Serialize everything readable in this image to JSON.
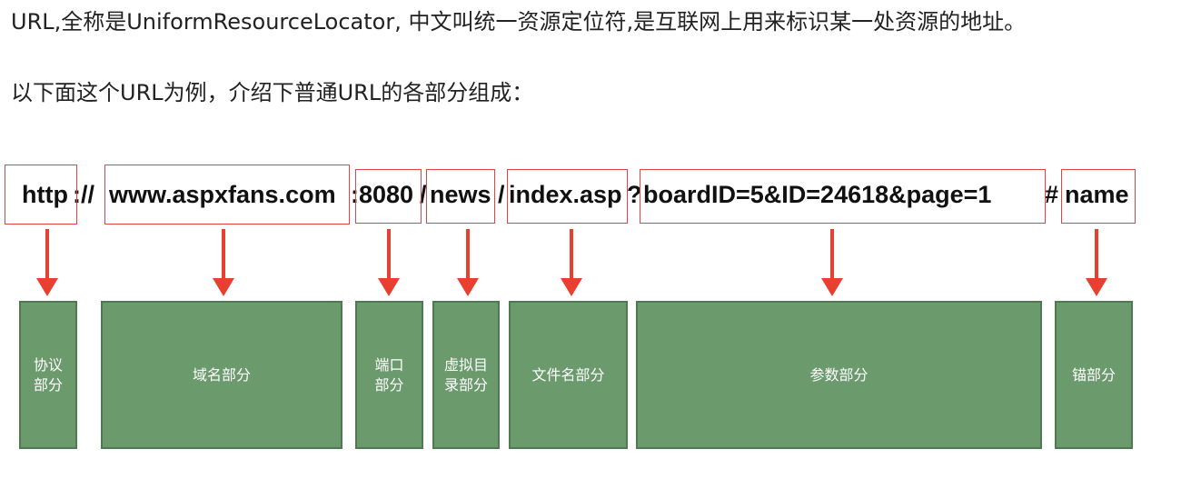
{
  "intro": "URL,全称是UniformResourceLocator, 中文叫统一资源定位符,是互联网上用来标识某一处资源的地址。",
  "lead": "以下面这个URL为例，介绍下普通URL的各部分组成：",
  "url": {
    "protocol": "http",
    "sep1": "://",
    "domain": "www.aspxfans.com",
    "sep2": ":",
    "port": "8080",
    "sep3": "/",
    "path": "news",
    "sep4": "/",
    "file": "index.asp",
    "sep5": "?",
    "params": "boardID=5&ID=24618&page=1",
    "sep6": "#",
    "anchor": "name"
  },
  "parts": {
    "protocol": [
      "协议",
      "部分"
    ],
    "domain": [
      "域名部分"
    ],
    "port": [
      "端口",
      "部分"
    ],
    "path": [
      "虚拟目",
      "录部分"
    ],
    "file": [
      "文件名部分"
    ],
    "params": [
      "参数部分"
    ],
    "anchor": [
      "锚部分"
    ]
  },
  "colors": {
    "box_fill": "#6b9a6d",
    "highlight": "#e04545",
    "arrow": "#e8402e"
  }
}
